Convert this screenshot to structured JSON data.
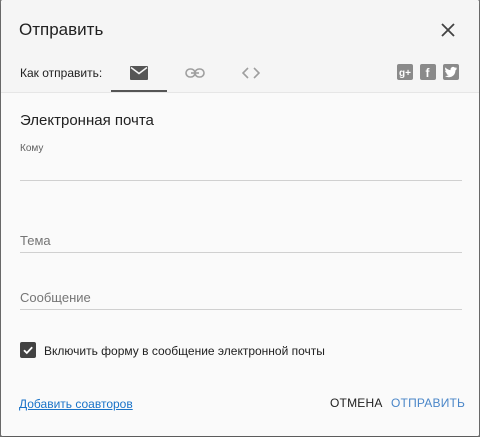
{
  "dialog": {
    "title": "Отправить",
    "send_via_label": "Как отправить:",
    "tabs": [
      {
        "name": "email",
        "icon": "mail-icon",
        "active": true
      },
      {
        "name": "link",
        "icon": "link-icon",
        "active": false
      },
      {
        "name": "embed",
        "icon": "code-icon",
        "active": false
      }
    ],
    "social": [
      {
        "name": "google-plus",
        "glyph": "g+"
      },
      {
        "name": "facebook",
        "glyph": "f"
      },
      {
        "name": "twitter",
        "glyph": "t"
      }
    ]
  },
  "email_form": {
    "section_title": "Электронная почта",
    "to_label": "Кому",
    "to_value": "",
    "subject_placeholder": "Тема",
    "message_placeholder": "Сообщение",
    "include_form_label": "Включить форму в сообщение электронной почты",
    "include_form_checked": true
  },
  "footer": {
    "add_collaborators": "Добавить соавторов",
    "cancel": "ОТМЕНА",
    "send": "ОТПРАВИТЬ"
  },
  "colors": {
    "link": "#1a73c8",
    "send_button": "#4a86c8",
    "icon_gray": "#8a8a8a"
  }
}
